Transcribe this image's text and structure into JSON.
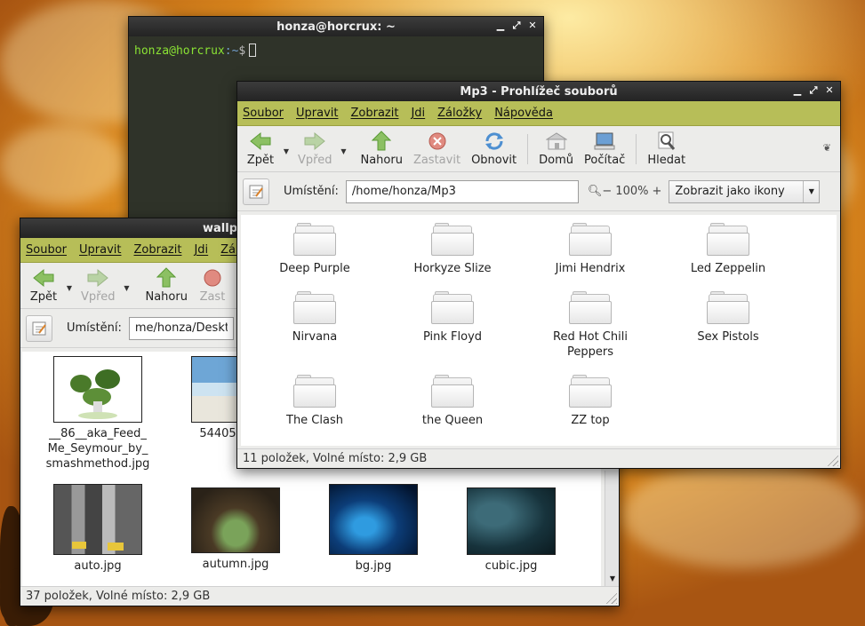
{
  "terminal": {
    "title": "honza@horcrux: ~",
    "prompt_user": "honza@horcrux",
    "prompt_path": ":~",
    "prompt_symbol": "$"
  },
  "wallpapers_window": {
    "title": "wallp",
    "menu": [
      "Soubor",
      "Upravit",
      "Zobrazit",
      "Jdi",
      "Zál"
    ],
    "toolbar": {
      "back": "Zpět",
      "forward": "Vpřed",
      "up": "Nahoru",
      "stop": "Zast"
    },
    "location_label": "Umístění:",
    "location_value": "me/honza/Deskt",
    "files": [
      {
        "name": "__86__aka_Feed_\nMe_Seymour_by_\nsmashmethod.jpg"
      },
      {
        "name": "54405"
      },
      {
        "name": "auto.jpg"
      },
      {
        "name": "autumn.jpg"
      },
      {
        "name": "bg.jpg"
      },
      {
        "name": "cubic.jpg"
      }
    ],
    "status": "37 položek, Volné místo: 2,9 GB"
  },
  "mp3_window": {
    "title": "Mp3 - Prohlížeč souborů",
    "menu": [
      "Soubor",
      "Upravit",
      "Zobrazit",
      "Jdi",
      "Záložky",
      "Nápověda"
    ],
    "toolbar": {
      "back": "Zpět",
      "forward": "Vpřed",
      "up": "Nahoru",
      "stop": "Zastavit",
      "reload": "Obnovit",
      "home": "Domů",
      "computer": "Počítač",
      "search": "Hledat"
    },
    "location_label": "Umístění:",
    "location_value": "/home/honza/Mp3",
    "zoom": "100%",
    "view_mode": "Zobrazit jako ikony",
    "folders": [
      "Deep Purple",
      "Horkyze Slize",
      "Jimi Hendrix",
      "Led Zeppelin",
      "Nirvana",
      "Pink Floyd",
      "Red Hot Chili\nPeppers",
      "Sex Pistols",
      "The Clash",
      "the Queen",
      "ZZ top"
    ],
    "status": "11 položek, Volné místo: 2,9 GB"
  },
  "colors": {
    "menubar": "#b7be58",
    "titlebar": "#2c2c2c",
    "terminal_bg": "#2f3329",
    "prompt_user": "#8ae234",
    "prompt_path": "#729fcf"
  }
}
